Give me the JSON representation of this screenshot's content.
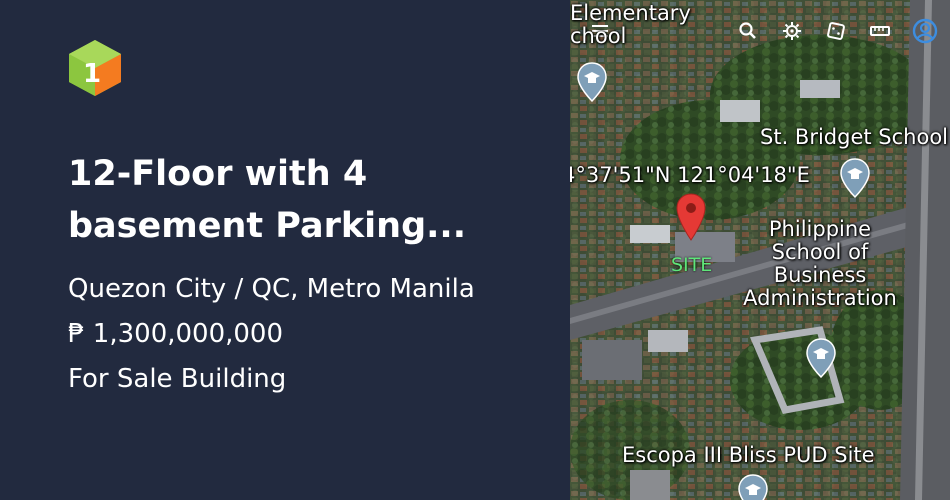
{
  "listing": {
    "title_line1": "12-Floor with 4",
    "title_line2": "basement Parking...",
    "location": "Quezon City / QC, Metro Manila",
    "price": "₱ 1,300,000,000",
    "type": "For Sale Building"
  },
  "map": {
    "labels": {
      "elementary_line1": "Elementary",
      "elementary_line2": "chool",
      "st_bridget": "St. Bridget School",
      "coordinates": "4°37'51\"N 121°04'18\"E",
      "site": "SITE",
      "psba_line1": "Philippine",
      "psba_line2": "School of",
      "psba_line3": "Business",
      "psba_line4": "Administration",
      "escopa": "Escopa III Bliss PUD Site"
    },
    "toolbar": [
      "menu-icon",
      "search-icon",
      "settings-icon",
      "dice-icon",
      "ruler-icon",
      "account-icon"
    ]
  },
  "colors": {
    "background": "#222a3f",
    "text": "#ffffff",
    "site_label": "#5fe67a",
    "pin_red": "#e53935",
    "school_pin": "#7f9fb8"
  }
}
